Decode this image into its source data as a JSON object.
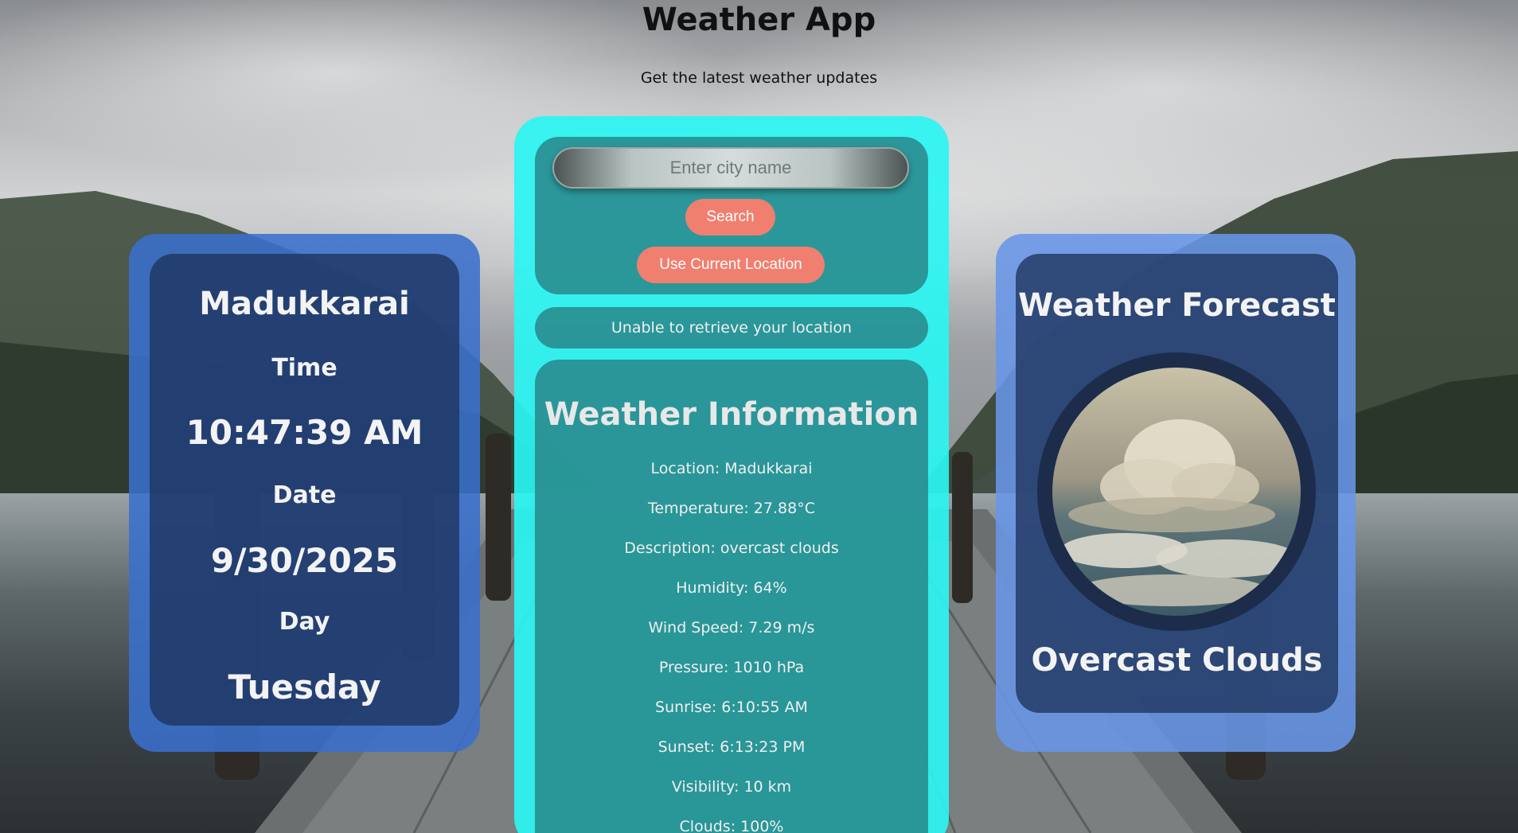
{
  "header": {
    "title": "Weather App",
    "subtitle": "Get the latest weather updates"
  },
  "left_card": {
    "city": "Madukkarai",
    "time_label": "Time",
    "time": "10:47:39 AM",
    "date_label": "Date",
    "date": "9/30/2025",
    "day_label": "Day",
    "day": "Tuesday"
  },
  "search": {
    "placeholder": "Enter city name",
    "value": "",
    "search_button": "Search",
    "location_button": "Use Current Location"
  },
  "status": {
    "message": "Unable to retrieve your location"
  },
  "weather_info": {
    "title": "Weather Information",
    "location": "Location: Madukkarai",
    "temperature": "Temperature: 27.88°C",
    "description": "Description: overcast clouds",
    "humidity": "Humidity: 64%",
    "wind": "Wind Speed: 7.29 m/s",
    "pressure": "Pressure: 1010 hPa",
    "sunrise": "Sunrise: 6:10:55 AM",
    "sunset": "Sunset: 6:13:23 PM",
    "visibility": "Visibility: 10 km",
    "clouds": "Clouds: 100%"
  },
  "forecast": {
    "title": "Weather Forecast",
    "description": "Overcast Clouds",
    "image_icon": "cloudy-sky-image"
  },
  "colors": {
    "left_card": "#3a70cd",
    "right_card": "#6896e8",
    "center_card": "#2af5f2",
    "panel": "#288286",
    "button": "#f07f70"
  }
}
